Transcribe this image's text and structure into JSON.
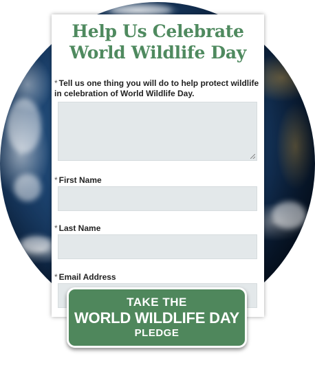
{
  "form": {
    "title_line1": "Help Us Celebrate",
    "title_line2": "World Wildlife Day",
    "required_marker": "*",
    "fields": [
      {
        "label_line1": "Tell us one thing you will do to help protect wildlife",
        "label_line2": "in celebration of World Wildlife Day.",
        "value": ""
      },
      {
        "label": "First Name",
        "value": ""
      },
      {
        "label": "Last Name",
        "value": ""
      },
      {
        "label": "Email Address",
        "value": ""
      }
    ]
  },
  "pledge_button": {
    "line1": "TAKE THE",
    "line2": "WORLD WILDLIFE DAY",
    "line3": "PLEDGE"
  },
  "colors": {
    "title_green": "#4f8a5f",
    "button_green": "#4f875c",
    "input_fill": "#e3e8ea"
  },
  "background": {
    "image": "earth-globe"
  }
}
